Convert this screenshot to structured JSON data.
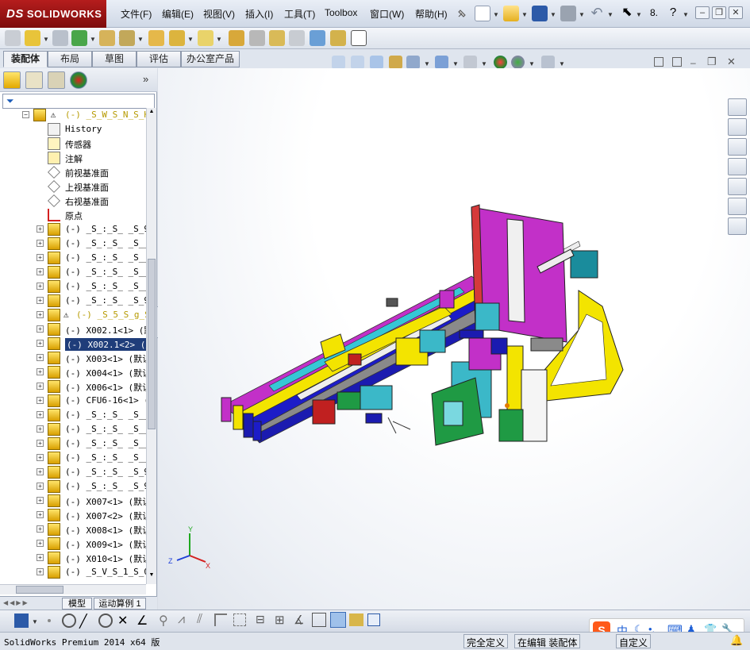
{
  "app": {
    "name": "SOLIDWORKS",
    "logo_prefix": "DS"
  },
  "menu": {
    "items": [
      "文件(F)",
      "编辑(E)",
      "视图(V)",
      "插入(I)",
      "工具(T)",
      "Toolbox",
      "窗口(W)",
      "帮助(H)"
    ]
  },
  "tabs": [
    "装配体",
    "布局",
    "草图",
    "评估",
    "办公室产品"
  ],
  "feature_tree": {
    "root": "(-) _S_W_S_N_S_H_",
    "items": [
      {
        "label": "History",
        "icon": "history-icon",
        "exp": ""
      },
      {
        "label": "传感器",
        "icon": "sensor-icon",
        "exp": ""
      },
      {
        "label": "注解",
        "icon": "annotation-icon",
        "exp": ""
      },
      {
        "label": "前视基准面",
        "icon": "plane-icon",
        "exp": ""
      },
      {
        "label": "上视基准面",
        "icon": "plane-icon",
        "exp": ""
      },
      {
        "label": "右视基准面",
        "icon": "plane-icon",
        "exp": ""
      },
      {
        "label": "原点",
        "icon": "origin-icon",
        "exp": ""
      },
      {
        "label": "(-) _S_:_S_ _S_9_",
        "icon": "subassembly-icon",
        "exp": "+"
      },
      {
        "label": "(-) _S_:_S_ _S___",
        "icon": "subassembly-icon",
        "exp": "+"
      },
      {
        "label": "(-) _S_:_S_ _S___",
        "icon": "subassembly-icon",
        "exp": "+"
      },
      {
        "label": "(-) _S_:_S_ _S___",
        "icon": "subassembly-icon",
        "exp": "+"
      },
      {
        "label": "(-) _S_:_S_ _S___",
        "icon": "subassembly-icon",
        "exp": "+"
      },
      {
        "label": "(-) _S_:_S_ _S_9_",
        "icon": "subassembly-icon",
        "exp": "+"
      },
      {
        "label": "(-) _S_5_S_g_S_",
        "icon": "warning-subassembly-icon",
        "exp": "+"
      },
      {
        "label": "(-) X002.1<1> (默",
        "icon": "subassembly-icon",
        "exp": "+"
      },
      {
        "label": "(-) X002.1<2> (默",
        "icon": "subassembly-icon",
        "exp": "+",
        "selected": true
      },
      {
        "label": "(-) X003<1> (默认",
        "icon": "subassembly-icon",
        "exp": "+"
      },
      {
        "label": "(-) X004<1> (默认",
        "icon": "subassembly-icon",
        "exp": "+"
      },
      {
        "label": "(-) X006<1> (默认",
        "icon": "subassembly-icon",
        "exp": "+"
      },
      {
        "label": "(-) CFU6-16<1> (",
        "icon": "subassembly-icon",
        "exp": "+"
      },
      {
        "label": "(-) _S_:_S_ _S___",
        "icon": "subassembly-icon",
        "exp": "+"
      },
      {
        "label": "(-) _S_:_S_ _S___",
        "icon": "subassembly-icon",
        "exp": "+"
      },
      {
        "label": "(-) _S_:_S_ _S___",
        "icon": "subassembly-icon",
        "exp": "+"
      },
      {
        "label": "(-) _S_:_S_ _S___",
        "icon": "subassembly-icon",
        "exp": "+"
      },
      {
        "label": "(-) _S_:_S_ _S_9_",
        "icon": "subassembly-icon",
        "exp": "+"
      },
      {
        "label": "(-) _S_:_S_ _S_9_",
        "icon": "subassembly-icon",
        "exp": "+"
      },
      {
        "label": "(-) X007<1> (默认",
        "icon": "subassembly-icon",
        "exp": "+"
      },
      {
        "label": "(-) X007<2> (默认",
        "icon": "subassembly-icon",
        "exp": "+"
      },
      {
        "label": "(-) X008<1> (默认",
        "icon": "subassembly-icon",
        "exp": "+"
      },
      {
        "label": "(-) X009<1> (默认",
        "icon": "subassembly-icon",
        "exp": "+"
      },
      {
        "label": "(-) X010<1> (默认",
        "icon": "subassembly-icon",
        "exp": "+"
      },
      {
        "label": "(-) _S_V_S_1_S_0_",
        "icon": "subassembly-icon",
        "exp": "+"
      }
    ]
  },
  "bottom_tabs": [
    "模型",
    "运动算例 1"
  ],
  "status": {
    "product": "SolidWorks Premium 2014 x64 版",
    "defined": "完全定义",
    "editing": "在编辑 装配体",
    "custom": "自定义"
  },
  "ime": {
    "lang": "中"
  },
  "triad": {
    "x": "X",
    "y": "Y",
    "z": "Z"
  },
  "colors": {
    "brand_red": "#a3161a",
    "selection_blue": "#1f3d7a",
    "warning_yellow": "#ffd400"
  }
}
